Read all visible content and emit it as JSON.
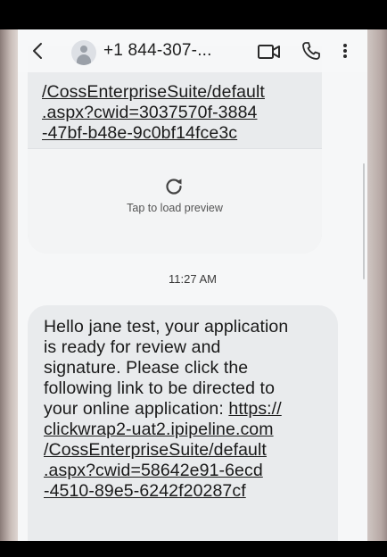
{
  "header": {
    "contact": "+1 844-307-..."
  },
  "ghost_text": ".aspx?cwid=3037570f-3884",
  "previous_message": {
    "link_lines": [
      "/CossEnterpriseSuite/default",
      ".aspx?cwid=3037570f-3884",
      "-47bf-b48e-9c0bf14fce3c"
    ]
  },
  "preview": {
    "label": "Tap to load preview",
    "icon": "reload-icon"
  },
  "timestamp": "11:27 AM",
  "message": {
    "lines": [
      "Hello jane test, your application",
      "is ready for review and",
      "signature. Please click the",
      "following link to be directed to",
      "your online application: "
    ],
    "link_start": "https://",
    "link_lines": [
      "clickwrap2-uat2.ipipeline.com",
      "/CossEnterpriseSuite/default",
      ".aspx?cwid=58642e91-6ecd",
      "-4510-89e5-6242f20287cf"
    ]
  },
  "icons": {
    "back": "chevron-left-icon",
    "avatar": "person-icon",
    "video": "video-call-icon",
    "call": "phone-icon",
    "more": "more-vertical-icon"
  }
}
